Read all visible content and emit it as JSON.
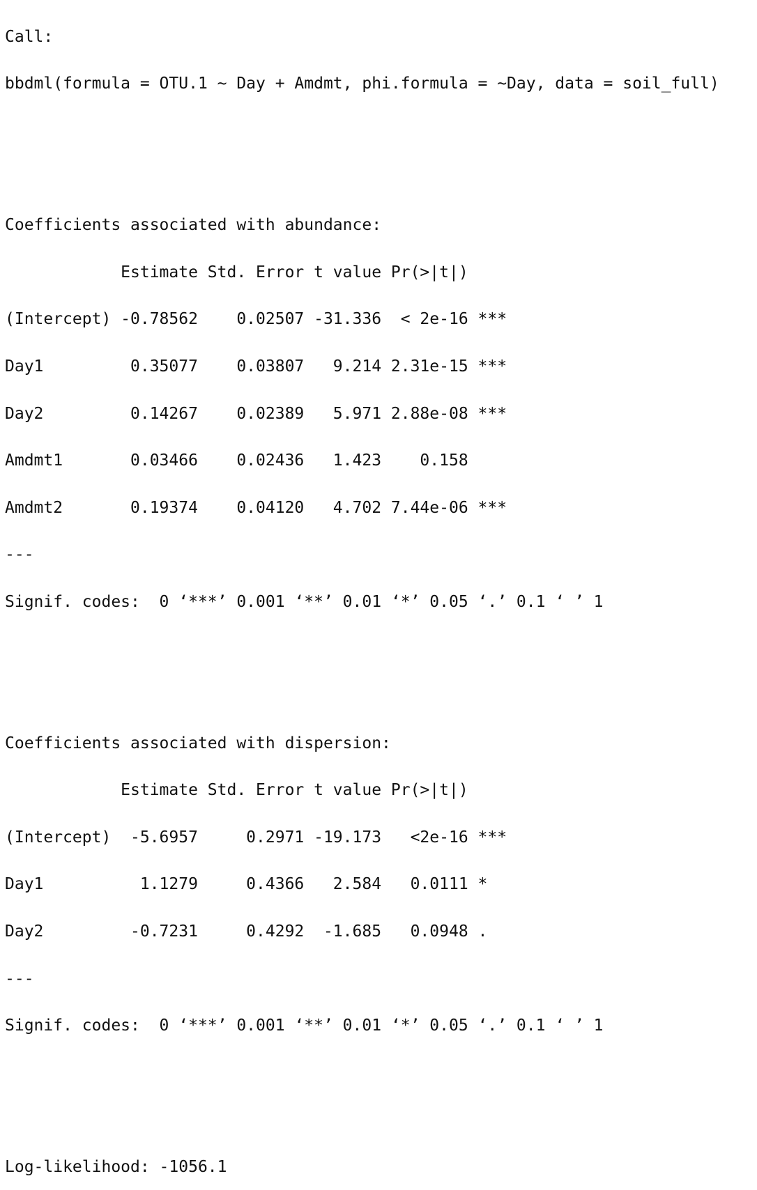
{
  "call": {
    "header": "Call:",
    "command": "bbdml(formula = OTU.1 ~ Day + Amdmt, phi.formula = ~Day, data = soil_full)"
  },
  "abundance": {
    "heading": "Coefficients associated with abundance:",
    "header_row": "            Estimate Std. Error t value Pr(>|t|)    ",
    "rows": [
      "(Intercept) -0.78562    0.02507 -31.336  < 2e-16 ***",
      "Day1         0.35077    0.03807   9.214 2.31e-15 ***",
      "Day2         0.14267    0.02389   5.971 2.88e-08 ***",
      "Amdmt1       0.03466    0.02436   1.423    0.158    ",
      "Amdmt2       0.19374    0.04120   4.702 7.44e-06 ***"
    ],
    "separator": "---",
    "signif": "Signif. codes:  0 ‘***’ 0.001 ‘**’ 0.01 ‘*’ 0.05 ‘.’ 0.1 ‘ ’ 1"
  },
  "dispersion": {
    "heading": "Coefficients associated with dispersion:",
    "header_row": "            Estimate Std. Error t value Pr(>|t|)    ",
    "rows": [
      "(Intercept)  -5.6957     0.2971 -19.173   <2e-16 ***",
      "Day1          1.1279     0.4366   2.584   0.0111 *  ",
      "Day2         -0.7231     0.4292  -1.685   0.0948 .  "
    ],
    "separator": "---",
    "signif": "Signif. codes:  0 ‘***’ 0.001 ‘**’ 0.01 ‘*’ 0.05 ‘.’ 0.1 ‘ ’ 1"
  },
  "loglik": "Log-likelihood: -1056.1"
}
